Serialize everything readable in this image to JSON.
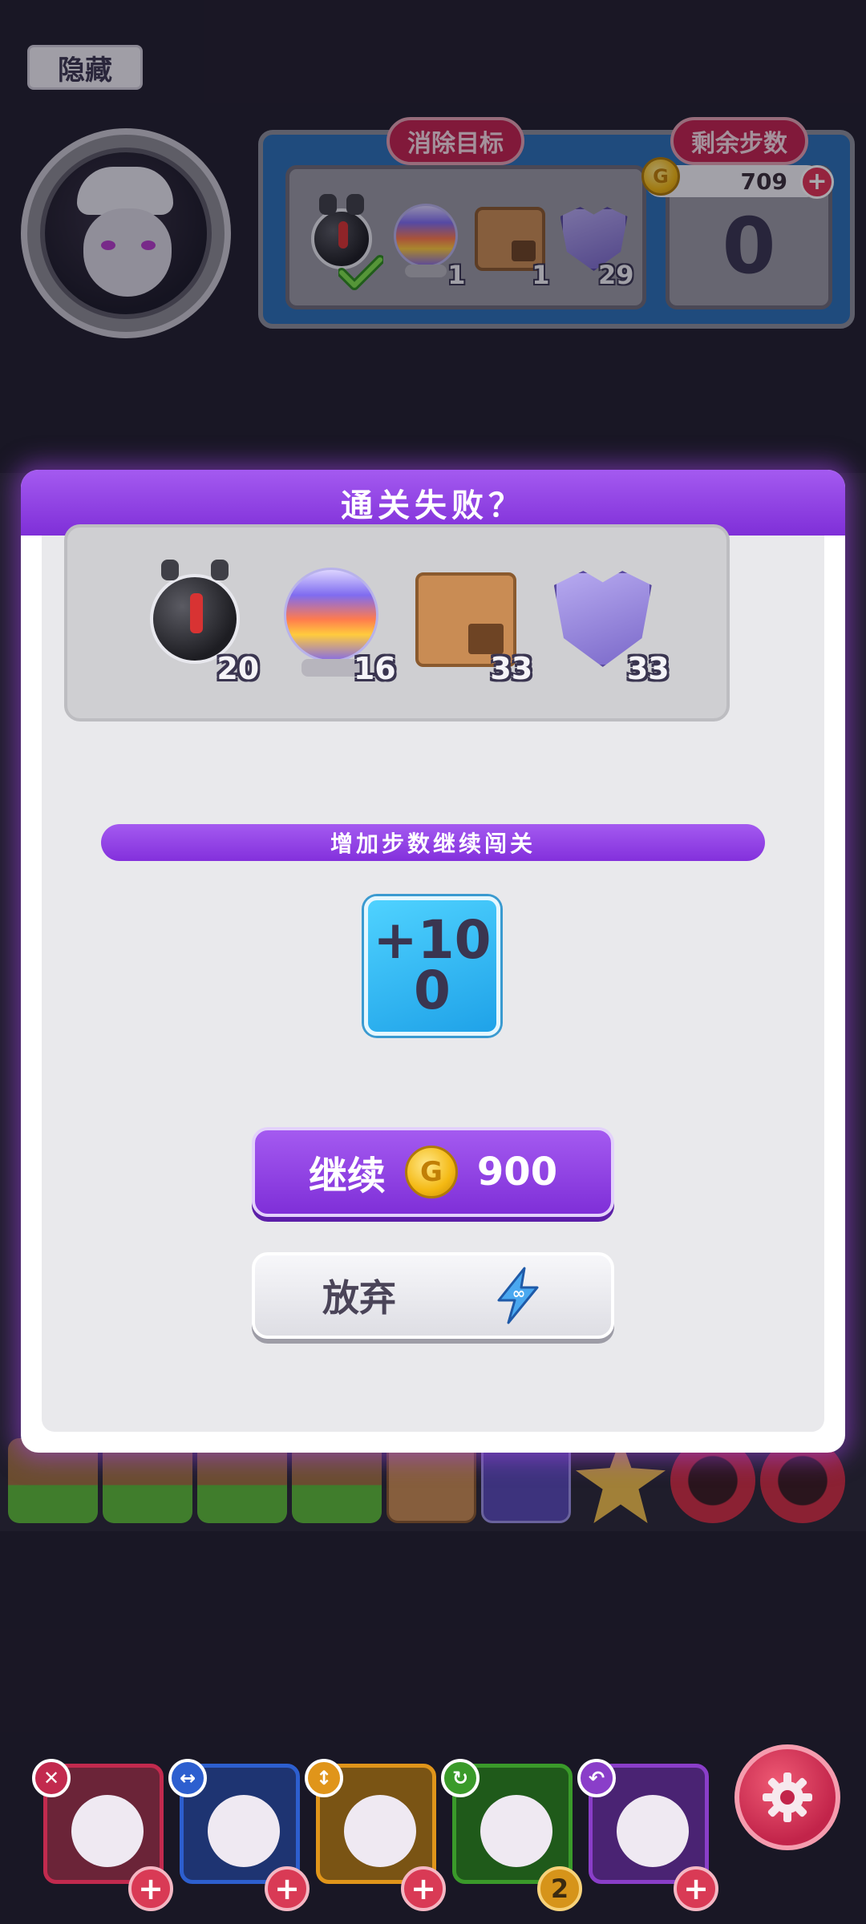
{
  "hud": {
    "hide_label": "隐藏",
    "goal_label": "消除目标",
    "steps_label": "剩余步数",
    "coins": "709",
    "steps_left": "0",
    "goals": [
      {
        "icon": "bomb-bot-icon",
        "count": "",
        "done": true
      },
      {
        "icon": "rainbow-orb-icon",
        "count": "1"
      },
      {
        "icon": "crate-icon",
        "count": "1"
      },
      {
        "icon": "bat-shield-icon",
        "count": "29"
      }
    ]
  },
  "modal": {
    "title": "通关失败？",
    "remaining": [
      {
        "icon": "bomb-bot-icon",
        "count": "20"
      },
      {
        "icon": "rainbow-orb-icon",
        "count": "16"
      },
      {
        "icon": "crate-icon",
        "count": "33"
      },
      {
        "icon": "bat-shield-icon",
        "count": "33"
      }
    ],
    "ribbon_text": "增加步数继续闯关",
    "boost": {
      "line1": "+10",
      "line2": "0"
    },
    "continue_label": "继续",
    "continue_cost": "900",
    "giveup_label": "放弃"
  },
  "heroes": [
    {
      "color": "#c22a4e",
      "skill_color": "#c22a4e",
      "badge": "+"
    },
    {
      "color": "#2d5fcf",
      "skill_color": "#2d5fcf",
      "badge": "+"
    },
    {
      "color": "#e0951a",
      "skill_color": "#e0951a",
      "badge": "+"
    },
    {
      "color": "#3a9a2a",
      "skill_color": "#3a9a2a",
      "badge": "2"
    },
    {
      "color": "#8a3ec9",
      "skill_color": "#8a3ec9",
      "badge": "+"
    }
  ],
  "colors": {
    "accent_purple": "#8f3fe0",
    "panel_blue": "#2c6fb5",
    "tag_red": "#c2234f",
    "coin_gold": "#f4b913"
  }
}
